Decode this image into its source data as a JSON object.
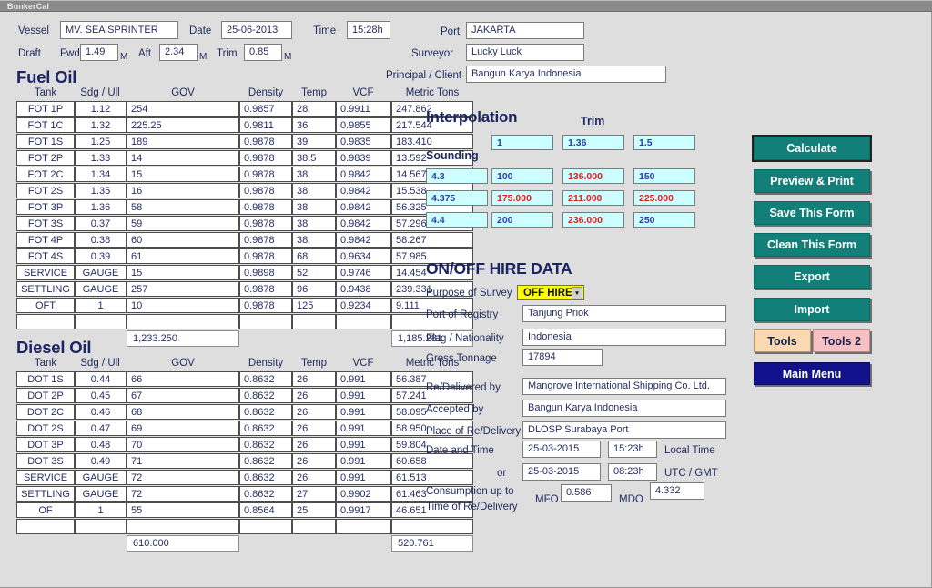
{
  "window": {
    "title": "BunkerCal"
  },
  "header": {
    "vessel_label": "Vessel",
    "vessel_value": "MV. SEA SPRINTER",
    "date_label": "Date",
    "date_value": "25-06-2013",
    "time_label": "Time",
    "time_value": "15:28h",
    "port_label": "Port",
    "port_value": "JAKARTA",
    "surveyor_label": "Surveyor",
    "surveyor_value": "Lucky Luck",
    "principal_label": "Principal / Client",
    "principal_value": "Bangun Karya Indonesia",
    "draft_label": "Draft",
    "fwd_label": "Fwd",
    "fwd_value": "1.49",
    "fwd_unit": "M",
    "aft_label": "Aft",
    "aft_value": "2.34",
    "aft_unit": "M",
    "trim_label": "Trim",
    "trim_value": "0.85",
    "trim_unit": "M"
  },
  "fuel_oil": {
    "title": "Fuel Oil",
    "columns": [
      "Tank",
      "Sdg / Ull",
      "GOV",
      "Density",
      "Temp",
      "VCF",
      "Metric Tons"
    ],
    "rows": [
      [
        "FOT 1P",
        "1.12",
        "254",
        "0.9857",
        "28",
        "0.9911",
        "247.862"
      ],
      [
        "FOT 1C",
        "1.32",
        "225.25",
        "0.9811",
        "36",
        "0.9855",
        "217.544"
      ],
      [
        "FOT 1S",
        "1.25",
        "189",
        "0.9878",
        "39",
        "0.9835",
        "183.410"
      ],
      [
        "FOT 2P",
        "1.33",
        "14",
        "0.9878",
        "38.5",
        "0.9839",
        "13.592"
      ],
      [
        "FOT 2C",
        "1.34",
        "15",
        "0.9878",
        "38",
        "0.9842",
        "14.567"
      ],
      [
        "FOT 2S",
        "1.35",
        "16",
        "0.9878",
        "38",
        "0.9842",
        "15.538"
      ],
      [
        "FOT 3P",
        "1.36",
        "58",
        "0.9878",
        "38",
        "0.9842",
        "56.325"
      ],
      [
        "FOT 3S",
        "0.37",
        "59",
        "0.9878",
        "38",
        "0.9842",
        "57.296"
      ],
      [
        "FOT 4P",
        "0.38",
        "60",
        "0.9878",
        "38",
        "0.9842",
        "58.267"
      ],
      [
        "FOT 4S",
        "0.39",
        "61",
        "0.9878",
        "68",
        "0.9634",
        "57.985"
      ],
      [
        "SERVICE",
        "GAUGE",
        "15",
        "0.9898",
        "52",
        "0.9746",
        "14.454"
      ],
      [
        "SETTLING",
        "GAUGE",
        "257",
        "0.9878",
        "96",
        "0.9438",
        "239.331"
      ],
      [
        "OFT",
        "1",
        "10",
        "0.9878",
        "125",
        "0.9234",
        "9.111"
      ],
      [
        "",
        "",
        "",
        "",
        "",
        "",
        ""
      ]
    ],
    "total_gov": "1,233.250",
    "total_mt": "1,185.281"
  },
  "diesel_oil": {
    "title": "Diesel Oil",
    "columns": [
      "Tank",
      "Sdg / Ull",
      "GOV",
      "Density",
      "Temp",
      "VCF",
      "Metric Tons"
    ],
    "rows": [
      [
        "DOT 1S",
        "0.44",
        "66",
        "0.8632",
        "26",
        "0.991",
        "56.387"
      ],
      [
        "DOT 2P",
        "0.45",
        "67",
        "0.8632",
        "26",
        "0.991",
        "57.241"
      ],
      [
        "DOT 2C",
        "0.46",
        "68",
        "0.8632",
        "26",
        "0.991",
        "58.095"
      ],
      [
        "DOT 2S",
        "0.47",
        "69",
        "0.8632",
        "26",
        "0.991",
        "58.950"
      ],
      [
        "DOT 3P",
        "0.48",
        "70",
        "0.8632",
        "26",
        "0.991",
        "59.804"
      ],
      [
        "DOT 3S",
        "0.49",
        "71",
        "0.8632",
        "26",
        "0.991",
        "60.658"
      ],
      [
        "SERVICE",
        "GAUGE",
        "72",
        "0.8632",
        "26",
        "0.991",
        "61.513"
      ],
      [
        "SETTLING",
        "GAUGE",
        "72",
        "0.8632",
        "27",
        "0.9902",
        "61.463"
      ],
      [
        "OF",
        "1",
        "55",
        "0.8564",
        "25",
        "0.9917",
        "46.651"
      ],
      [
        "",
        "",
        "",
        "",
        "",
        "",
        ""
      ]
    ],
    "total_gov": "610.000",
    "total_mt": "520.761"
  },
  "interpolation": {
    "title": "Interpolation",
    "trim_label": "Trim",
    "sounding_label": "Sounding",
    "trim_values": [
      "1",
      "1.36",
      "1.5"
    ],
    "grid": [
      {
        "sounding": "4.3",
        "cells": [
          {
            "value": "100",
            "highlight": false
          },
          {
            "value": "136.000",
            "highlight": true
          },
          {
            "value": "150",
            "highlight": false
          }
        ]
      },
      {
        "sounding": "4.375",
        "cells": [
          {
            "value": "175.000",
            "highlight": true
          },
          {
            "value": "211.000",
            "highlight": true
          },
          {
            "value": "225.000",
            "highlight": true
          }
        ]
      },
      {
        "sounding": "4.4",
        "cells": [
          {
            "value": "200",
            "highlight": false
          },
          {
            "value": "236.000",
            "highlight": true
          },
          {
            "value": "250",
            "highlight": false
          }
        ]
      }
    ]
  },
  "hire": {
    "title": "ON/OFF HIRE DATA",
    "purpose_label": "Purpose of Survey",
    "purpose_value": "OFF HIRE",
    "port_registry_label": "Port of Registry",
    "port_registry_value": "Tanjung Priok",
    "flag_label": "Flag / Nationality",
    "flag_value": "Indonesia",
    "gross_tonnage_label": "Gross Tonnage",
    "gross_tonnage_value": "17894",
    "redelivered_label": "Re/Delivered by",
    "redelivered_value": "Mangrove International Shipping Co. Ltd.",
    "accepted_label": "Accepted by",
    "accepted_value": "Bangun Karya Indonesia",
    "place_label": "Place of Re/Delivery",
    "place_value": "DLOSP Surabaya Port",
    "datetime_label": "Date and Time",
    "local_date": "25-03-2015",
    "local_time": "15:23h",
    "local_time_label": "Local Time",
    "or_label": "or",
    "utc_date": "25-03-2015",
    "utc_time": "08:23h",
    "utc_label": "UTC / GMT",
    "consumption_label_1": "Consumption up to",
    "consumption_label_2": "Time of Re/Delivery",
    "mfo_label": "MFO",
    "mfo_value": "0.586",
    "mdo_label": "MDO",
    "mdo_value": "4.332"
  },
  "buttons": {
    "calculate": "Calculate",
    "preview_print": "Preview & Print",
    "save_form": "Save This Form",
    "clean_form": "Clean This Form",
    "export": "Export",
    "import": "Import",
    "tools": "Tools",
    "tools2": "Tools 2",
    "main_menu": "Main Menu"
  },
  "colors": {
    "background": "#dedede",
    "button_teal": "#128079",
    "button_navy": "#12128c",
    "tools_peach": "#fbd9b0",
    "tools_pink": "#f8c0c0",
    "interp_cyan": "#ccffff",
    "dropdown_yellow": "#ffff00",
    "text_navy": "#1f2a5e",
    "highlight_red": "#e02020"
  }
}
